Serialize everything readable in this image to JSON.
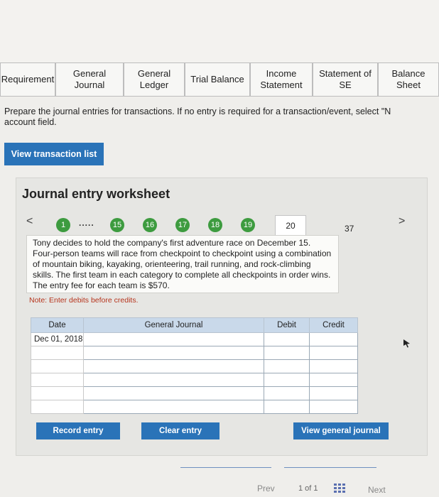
{
  "tabs": [
    {
      "label": "Requirement",
      "active": false
    },
    {
      "label": "General Journal",
      "active": false
    },
    {
      "label": "General Ledger",
      "active": false
    },
    {
      "label": "Trial Balance",
      "active": false
    },
    {
      "label": "Income Statement",
      "active": false
    },
    {
      "label": "Statement of SE",
      "active": false
    },
    {
      "label": "Balance Sheet",
      "active": false
    }
  ],
  "instructions": {
    "line1": "Prepare the journal entries for transactions. If no entry is required for a transaction/event, select \"N",
    "line2": "account field."
  },
  "view_transaction_list": "View transaction list",
  "worksheet": {
    "title": "Journal entry worksheet",
    "prev_arrow": "<",
    "next_arrow": ">",
    "steps": {
      "first": "1",
      "dots": ".....",
      "s15": "15",
      "s16": "16",
      "s17": "17",
      "s18": "18",
      "s19": "19",
      "current": "20",
      "last": "37"
    },
    "description": "Tony decides to hold the company's first adventure race on December 15. Four-person teams will race from checkpoint to checkpoint using a combination of mountain biking, kayaking, orienteering, trail running, and rock-climbing skills. The first team in each category to complete all checkpoints in order wins. The entry fee for each team is $570.",
    "note": "Note: Enter debits before credits.",
    "table": {
      "headers": {
        "date": "Date",
        "account": "General Journal",
        "debit": "Debit",
        "credit": "Credit"
      },
      "first_date": "Dec 01, 2018"
    },
    "buttons": {
      "record": "Record entry",
      "clear": "Clear entry",
      "view_journal": "View general journal"
    }
  },
  "pagination": {
    "prev": "Prev",
    "page": "1 of 1",
    "next": "Next"
  },
  "colors": {
    "accent_blue": "#2a73b8",
    "step_green": "#3d9b3f",
    "note_red": "#b6341c",
    "header_blue": "#c9d9ea"
  }
}
